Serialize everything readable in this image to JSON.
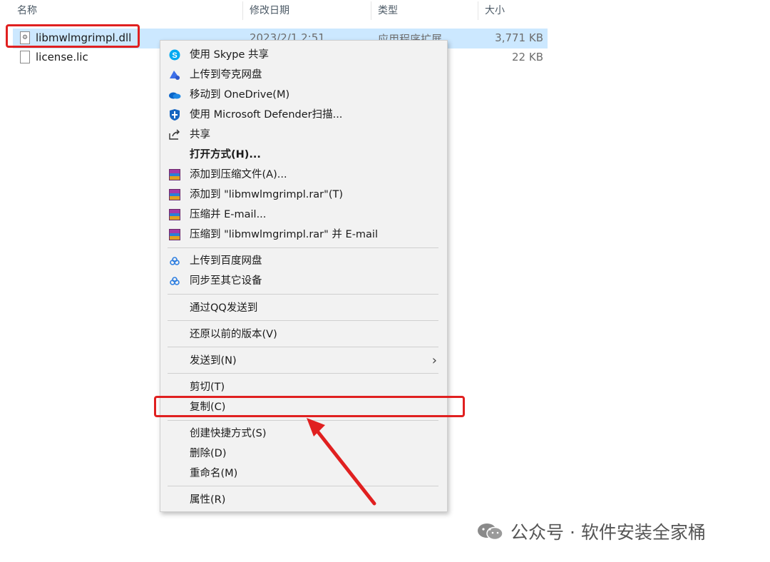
{
  "columns": {
    "name": "名称",
    "date": "修改日期",
    "type": "类型",
    "size": "大小"
  },
  "files": [
    {
      "name": "libmwlmgrimpl.dll",
      "date": "2023/2/1 2:51",
      "type": "应用程序扩展",
      "size": "3,771 KB",
      "selected": true
    },
    {
      "name": "license.lic",
      "date": "",
      "type": "",
      "size": "22 KB",
      "selected": false
    }
  ],
  "menu": {
    "skype_share": "使用 Skype 共享",
    "quark_upload": "上传到夸克网盘",
    "onedrive_move": "移动到 OneDrive(M)",
    "defender_scan": "使用 Microsoft Defender扫描...",
    "share": "共享",
    "open_with": "打开方式(H)...",
    "add_to_archive": "添加到压缩文件(A)...",
    "add_to_rar": "添加到 \"libmwlmgrimpl.rar\"(T)",
    "compress_email": "压缩并 E-mail...",
    "compress_rar_email": "压缩到 \"libmwlmgrimpl.rar\" 并 E-mail",
    "baidu_upload": "上传到百度网盘",
    "sync_devices": "同步至其它设备",
    "send_via_qq": "通过QQ发送到",
    "restore_versions": "还原以前的版本(V)",
    "send_to": "发送到(N)",
    "cut": "剪切(T)",
    "copy": "复制(C)",
    "create_shortcut": "创建快捷方式(S)",
    "delete": "删除(D)",
    "rename": "重命名(M)",
    "properties": "属性(R)"
  },
  "watermark": {
    "text": "公众号 · 软件安装全家桶"
  },
  "colors": {
    "highlight": "#e02020",
    "selection": "#cce8ff",
    "menu_bg": "#f2f2f2"
  },
  "icons": [
    "sort-up-icon",
    "dll-file-icon",
    "file-icon",
    "skype-icon",
    "quark-icon",
    "onedrive-icon",
    "defender-icon",
    "share-icon",
    "winrar-icon",
    "baidu-netdisk-icon",
    "chevron-right-icon",
    "wechat-icon"
  ]
}
